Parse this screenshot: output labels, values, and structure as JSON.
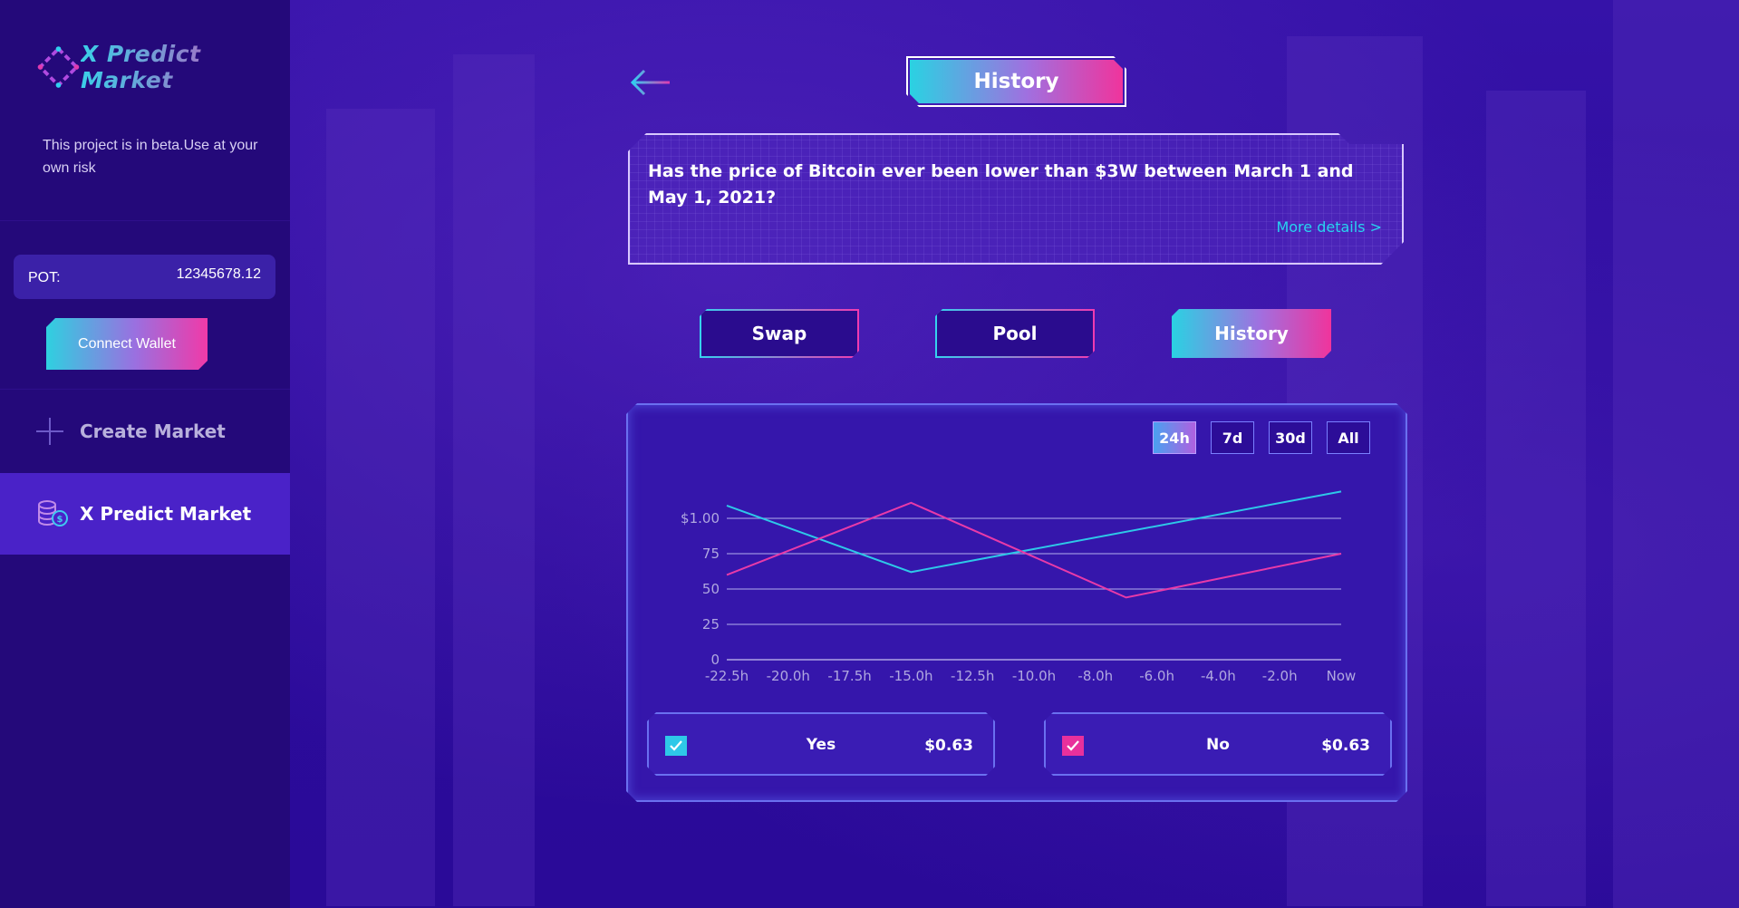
{
  "brand": {
    "name": "X Predict Market"
  },
  "sidebar": {
    "beta_notice": "This project is in beta.Use at your own risk",
    "pot_label": "POT:",
    "pot_value": "12345678.12",
    "connect_label": "Connect Wallet",
    "items": [
      {
        "label": "Create Market",
        "icon": "plus-icon"
      },
      {
        "label": "X Predict Market",
        "icon": "coins-icon",
        "active": true
      }
    ]
  },
  "header": {
    "title": "History",
    "back_icon": "arrow-left-icon"
  },
  "question": {
    "text": "Has the price of Bitcoin ever been lower than $3W between March 1 and May 1, 2021?",
    "more_label": "More details >"
  },
  "tabs": [
    {
      "label": "Swap",
      "active": false
    },
    {
      "label": "Pool",
      "active": false
    },
    {
      "label": "History",
      "active": true
    }
  ],
  "ranges": [
    "24h",
    "7d",
    "30d",
    "All"
  ],
  "active_range": "24h",
  "chart_data": {
    "type": "line",
    "x": [
      "-22.5h",
      "-20.0h",
      "-17.5h",
      "-15.0h",
      "-12.5h",
      "-10.0h",
      "-8.0h",
      "-6.0h",
      "-4.0h",
      "-2.0h",
      "Now"
    ],
    "y_ticks": [
      "0",
      "25",
      "50",
      "75",
      "$1.00"
    ],
    "ylim": [
      0,
      100
    ],
    "grid": true,
    "series": [
      {
        "name": "Yes",
        "color": "#2ec8e8",
        "points": [
          [
            0,
            109
          ],
          [
            3,
            62
          ],
          [
            10,
            119
          ]
        ]
      },
      {
        "name": "No",
        "color": "#e83aa8",
        "points": [
          [
            0,
            60
          ],
          [
            3,
            111
          ],
          [
            6.5,
            44
          ],
          [
            10,
            75
          ]
        ]
      }
    ]
  },
  "choices": [
    {
      "name": "Yes",
      "price": "$0.63",
      "color": "#2ec8e8"
    },
    {
      "name": "No",
      "price": "$0.63",
      "color": "#e8309c"
    }
  ]
}
